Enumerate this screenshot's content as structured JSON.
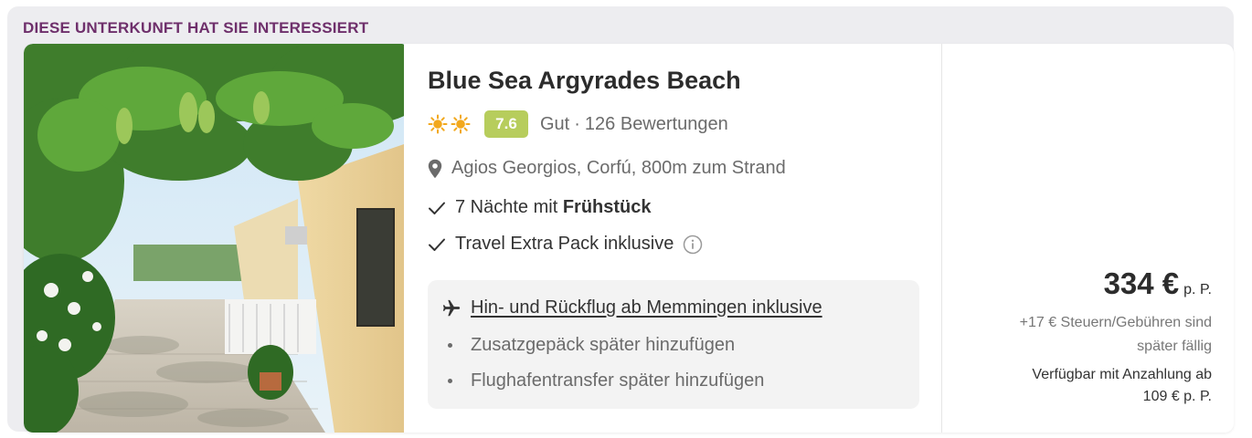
{
  "banner": "DIESE UNTERKUNFT HAT SIE INTERESSIERT",
  "hotel": {
    "name": "Blue Sea Argyrades Beach",
    "stars": 2,
    "score": "7.6",
    "rating_word": "Gut",
    "reviews": "126 Bewertungen",
    "location": "Agios Georgios, Corfú, 800m zum Strand"
  },
  "features": {
    "nights_prefix": "7 Nächte mit ",
    "nights_board": "Frühstück",
    "extra_pack": "Travel Extra Pack inklusive"
  },
  "flight": {
    "main": "Hin- und Rückflug ab Memmingen inklusive",
    "sub": [
      "Zusatzgepäck später hinzufügen",
      "Flughafentransfer später hinzufügen"
    ]
  },
  "price": {
    "amount": "334 €",
    "unit": "p. P.",
    "fees_line1": "+17 € Steuern/Gebühren sind",
    "fees_line2": "später fällig",
    "deposit_line1": "Verfügbar mit Anzahlung ab",
    "deposit_line2": "109 € p. P."
  },
  "colors": {
    "banner_text": "#6e2f6b",
    "score_badge": "#b7cd5c",
    "sun": "#f2a81d",
    "frame": "#ededf0"
  },
  "icons": [
    "sun-icon",
    "location-pin-icon",
    "check-icon",
    "info-icon",
    "airplane-icon"
  ]
}
